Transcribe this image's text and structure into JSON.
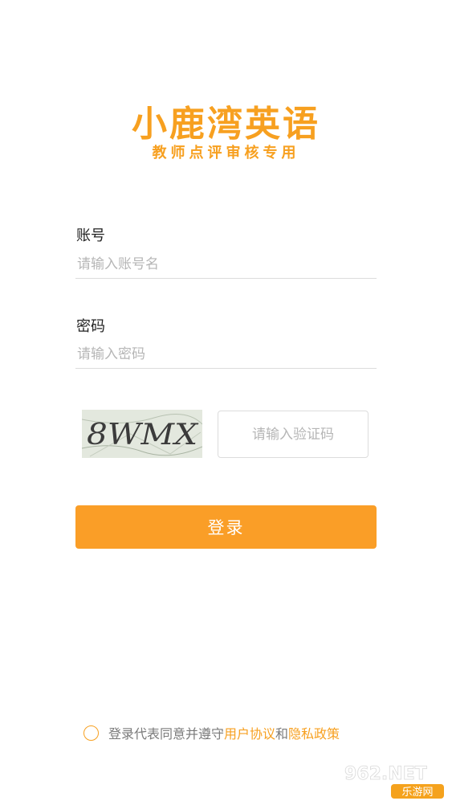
{
  "brand": {
    "title": "小鹿湾英语",
    "subtitle": "教师点评审核专用",
    "accent_color": "#f7a020"
  },
  "form": {
    "account_label": "账号",
    "account_placeholder": "请输入账号名",
    "password_label": "密码",
    "password_placeholder": "请输入密码",
    "captcha_text": "8WMX",
    "captcha_placeholder": "请输入验证码",
    "login_button": "登录",
    "login_color": "#fa9e27"
  },
  "agreement": {
    "prefix": "登录代表同意并遵守",
    "user_agreement": "用户协议",
    "and": "和",
    "privacy_policy": "隐私政策"
  },
  "watermark": {
    "brand": "962.NET",
    "label": "乐游网"
  }
}
